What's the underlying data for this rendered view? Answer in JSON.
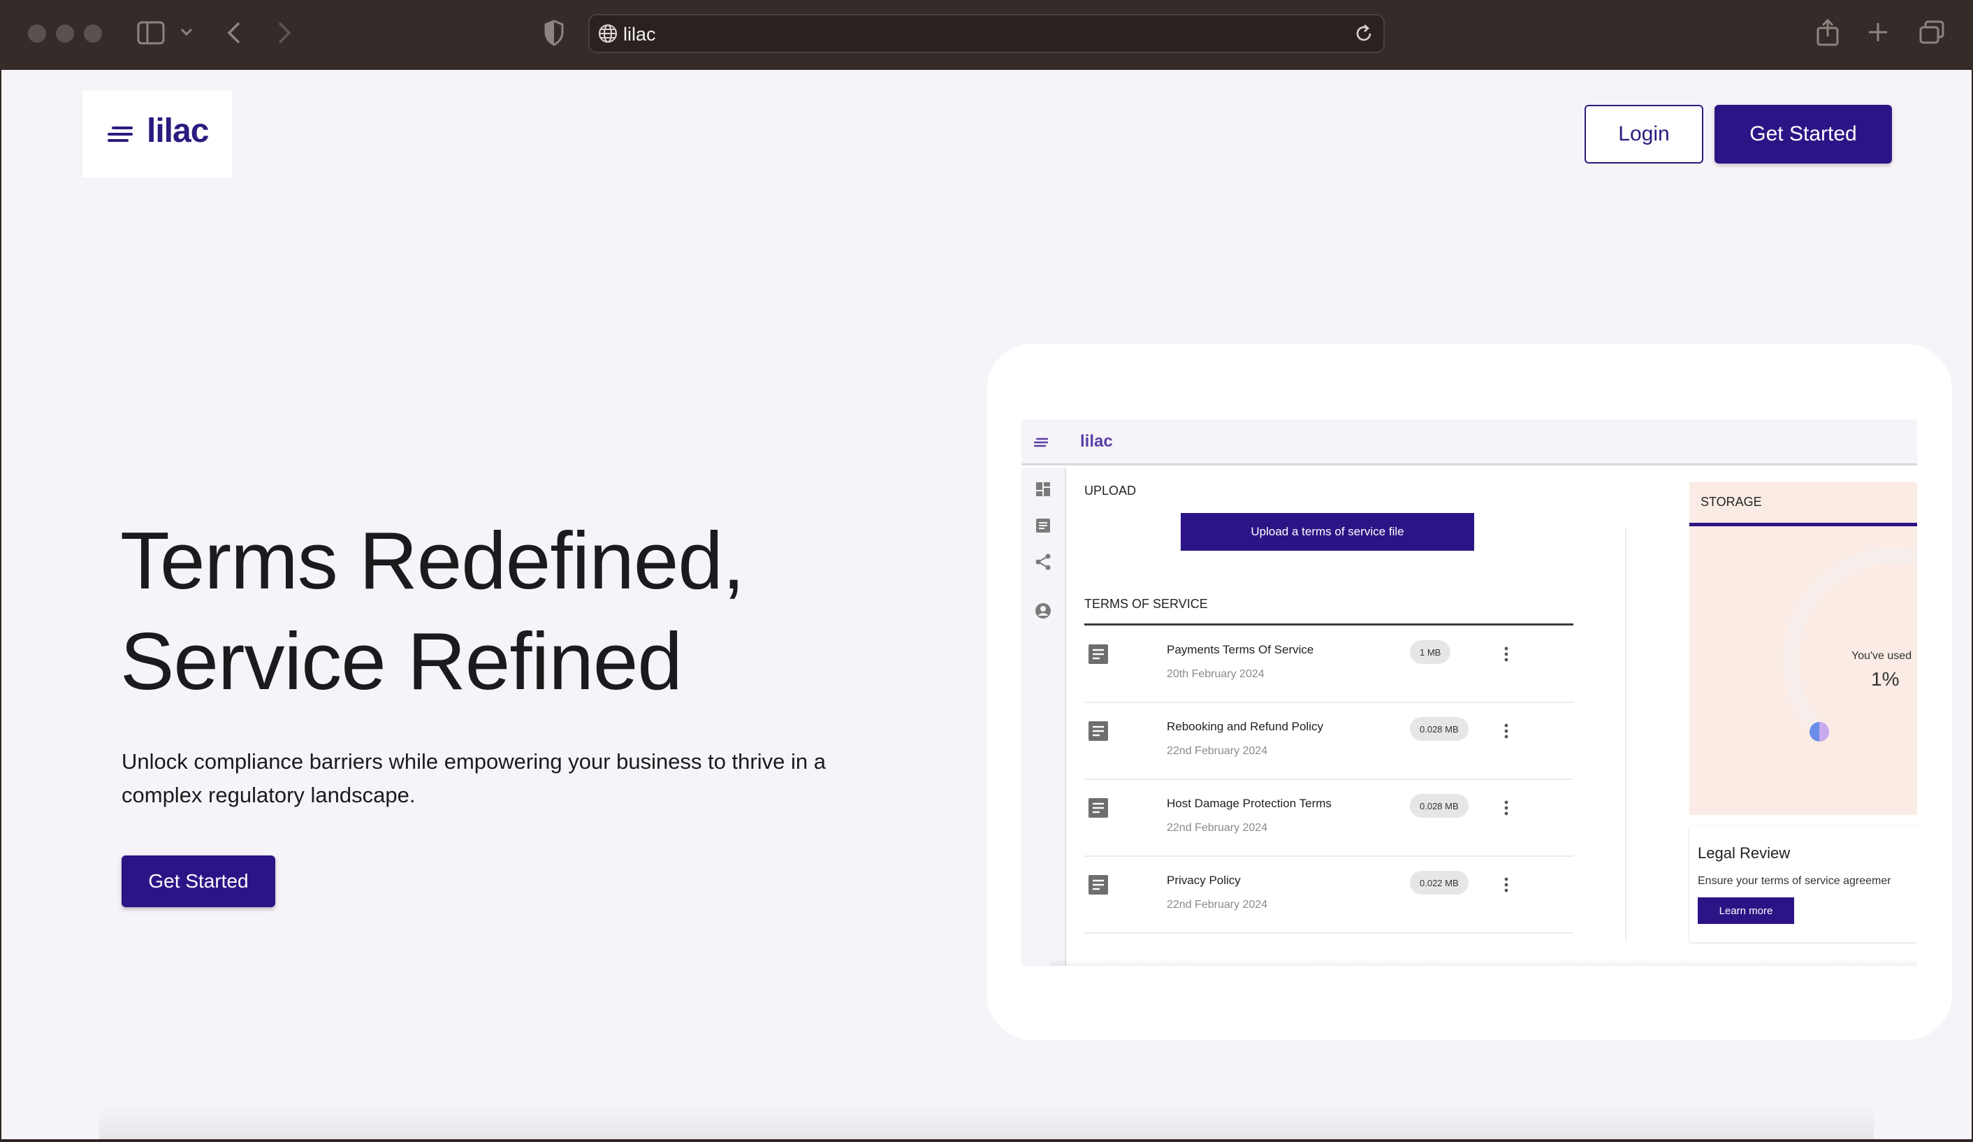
{
  "browser": {
    "url": "lilac"
  },
  "header": {
    "logo": "lilac",
    "login_label": "Login",
    "get_started_label": "Get Started"
  },
  "hero": {
    "title_line1": "Terms Redefined,",
    "title_line2": "Service Refined",
    "subtitle": "Unlock compliance barriers while empowering your business to thrive in a complex regulatory landscape.",
    "cta_label": "Get Started"
  },
  "preview": {
    "logo": "lilac",
    "upload_heading": "UPLOAD",
    "upload_button": "Upload a terms of service file",
    "tos_heading": "TERMS OF SERVICE",
    "documents": [
      {
        "title": "Payments Terms Of Service",
        "date": "20th February 2024",
        "size": "1 MB"
      },
      {
        "title": "Rebooking and Refund Policy",
        "date": "22nd February 2024",
        "size": "0.028 MB"
      },
      {
        "title": "Host Damage Protection Terms",
        "date": "22nd February 2024",
        "size": "0.028 MB"
      },
      {
        "title": "Privacy Policy",
        "date": "22nd February 2024",
        "size": "0.022 MB"
      }
    ],
    "storage": {
      "heading": "STORAGE",
      "used_label": "You've used",
      "used_value": "1%",
      "used_fraction": 0.01
    },
    "legal_review": {
      "title": "Legal Review",
      "text": "Ensure your terms of service agreemer",
      "button": "Learn more"
    }
  },
  "colors": {
    "brand": "#2d1486",
    "logo": "#2d1a7e",
    "page_bg": "#f6f4f8",
    "storage_bg": "#faece4"
  },
  "icons": [
    "globe-icon",
    "reload-icon",
    "menu-icon",
    "dashboard-icon",
    "document-icon",
    "share-icon",
    "account-icon",
    "more-vert-icon"
  ]
}
